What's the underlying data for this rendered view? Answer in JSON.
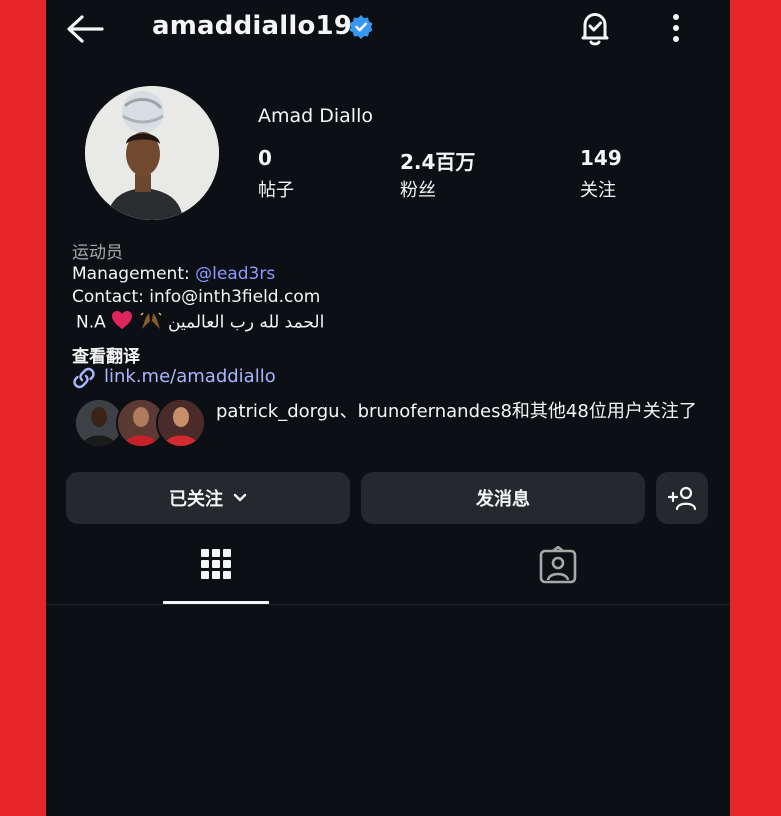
{
  "header": {
    "username": "amaddiallo19",
    "back_icon": "arrow-left-icon",
    "verified_icon": "verified-badge-icon",
    "notify_icon": "bell-check-icon",
    "more_icon": "more-vertical-icon",
    "verified_color": "#3897f0"
  },
  "profile": {
    "full_name": "Amad Diallo",
    "stats": [
      {
        "value": "0",
        "label": "帖子"
      },
      {
        "value": "2.4百万",
        "label": "粉丝"
      },
      {
        "value": "149",
        "label": "关注"
      }
    ]
  },
  "bio": {
    "category": "运动员",
    "management_prefix": "Management: ",
    "management_handle": "@lead3rs",
    "contact": "Contact: info@inth3field.com",
    "line3_text": "N.A",
    "line3_arabic": "الحمد لله رب العالمين",
    "translate": "查看翻译",
    "link": "link.me/amaddiallo",
    "link_color": "#a9b6ff"
  },
  "followed_by": {
    "text": "patrick_dorgu、brunofernandes8和其他48位用户关注了"
  },
  "actions": {
    "following_label": "已关注",
    "message_label": "发消息",
    "add_user_icon": "add-user-icon"
  },
  "tabs": [
    {
      "name": "grid",
      "icon": "grid-icon",
      "active": true
    },
    {
      "name": "tagged",
      "icon": "tagged-person-icon",
      "active": false
    }
  ],
  "colors": {
    "background": "#0c1014",
    "frame": "#e8262a",
    "button_bg": "#25292e"
  }
}
